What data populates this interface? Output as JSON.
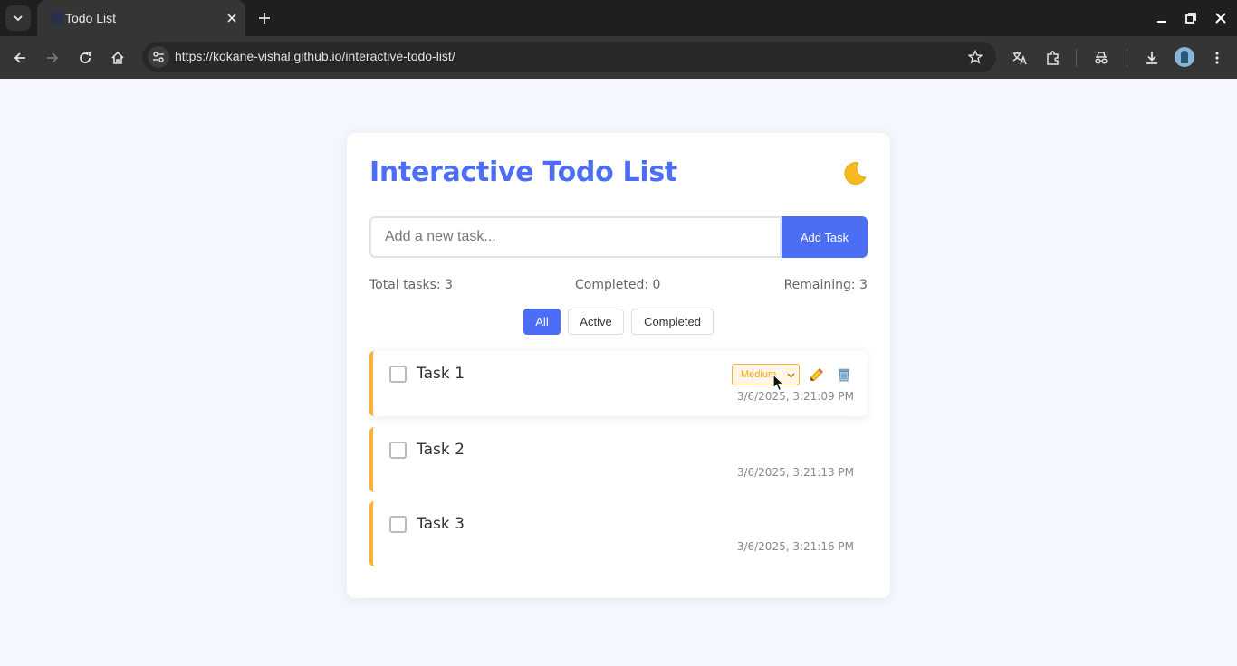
{
  "browser": {
    "tab_title": "Todo List",
    "url": "https://kokane-vishal.github.io/interactive-todo-list/"
  },
  "app": {
    "title": "Interactive Todo List",
    "theme_icon": "moon-icon",
    "input_placeholder": "Add a new task...",
    "input_value": "",
    "add_button": "Add Task"
  },
  "stats": {
    "total": "Total tasks: 3",
    "completed": "Completed: 0",
    "remaining": "Remaining: 3"
  },
  "filters": [
    {
      "label": "All",
      "active": true
    },
    {
      "label": "Active",
      "active": false
    },
    {
      "label": "Completed",
      "active": false
    }
  ],
  "tasks": [
    {
      "text": "Task 1",
      "time": "3/6/2025, 3:21:09 PM",
      "priority": "Medium",
      "completed": false
    },
    {
      "text": "Task 2",
      "time": "3/6/2025, 3:21:13 PM",
      "priority": "Medium",
      "completed": false
    },
    {
      "text": "Task 3",
      "time": "3/6/2025, 3:21:16 PM",
      "priority": "Medium",
      "completed": false
    }
  ],
  "colors": {
    "accent": "#4c6ef5",
    "priority_medium": "#f9b233",
    "page_bg": "#f4f7fd"
  }
}
